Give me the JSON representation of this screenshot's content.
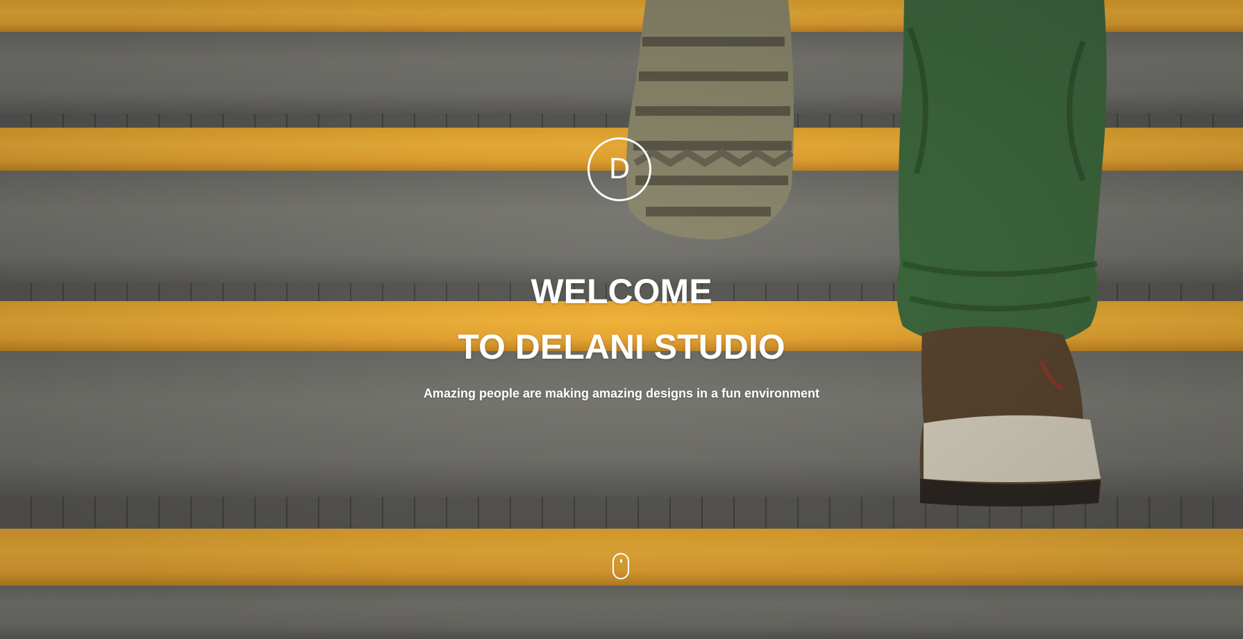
{
  "logo": {
    "letter": "D"
  },
  "hero": {
    "title_line1": "WELCOME",
    "title_line2": "TO DELANI STUDIO",
    "subtitle": "Amazing people are making amazing designs in a fun environment"
  },
  "icons": {
    "logo": "logo-circle-d-icon",
    "scroll": "mouse-scroll-icon"
  },
  "colors": {
    "stair_yellow": "#f2b43a",
    "stair_grey": "#7c7b75",
    "text": "#ffffff"
  }
}
